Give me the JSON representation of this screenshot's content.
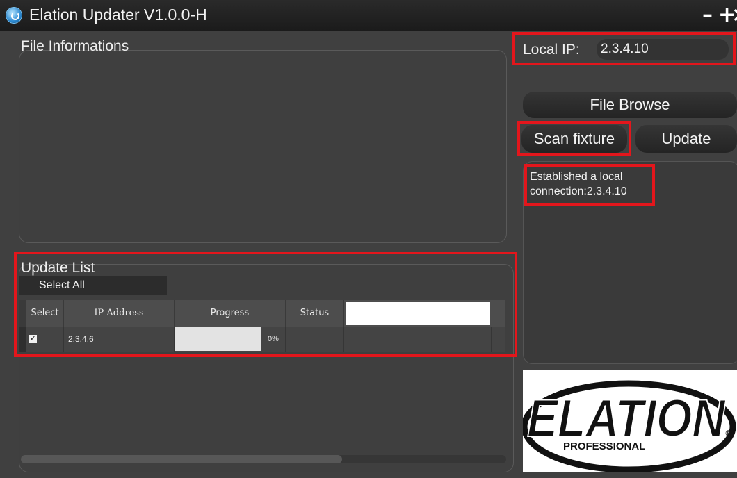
{
  "window": {
    "title": "Elation Updater V1.0.0-H",
    "controls": {
      "minimize": "–",
      "maximize": "+",
      "close": "×"
    }
  },
  "file_info": {
    "title": "File Informations"
  },
  "local_ip": {
    "label": "Local IP:",
    "value": "2.3.4.10"
  },
  "buttons": {
    "file_browse": "File Browse",
    "scan_fixture": "Scan fixture",
    "update": "Update"
  },
  "log": {
    "line1": "Established a local",
    "line2": "connection:2.3.4.10"
  },
  "update_list": {
    "title": "Update List",
    "select_all": "Select All",
    "columns": [
      "Select",
      "IP Address",
      "Progress",
      "Status"
    ],
    "rows": [
      {
        "selected": true,
        "ip": "2.3.4.6",
        "progress": 0,
        "progress_label": "0%",
        "status": ""
      }
    ]
  },
  "logo": {
    "brand": "ELATION",
    "sub": "PROFESSIONAL",
    "mark": "®"
  },
  "colors": {
    "annotation_red": "#e3161c",
    "window_bg": "#404040",
    "titlebar": "#1f1f1f"
  }
}
